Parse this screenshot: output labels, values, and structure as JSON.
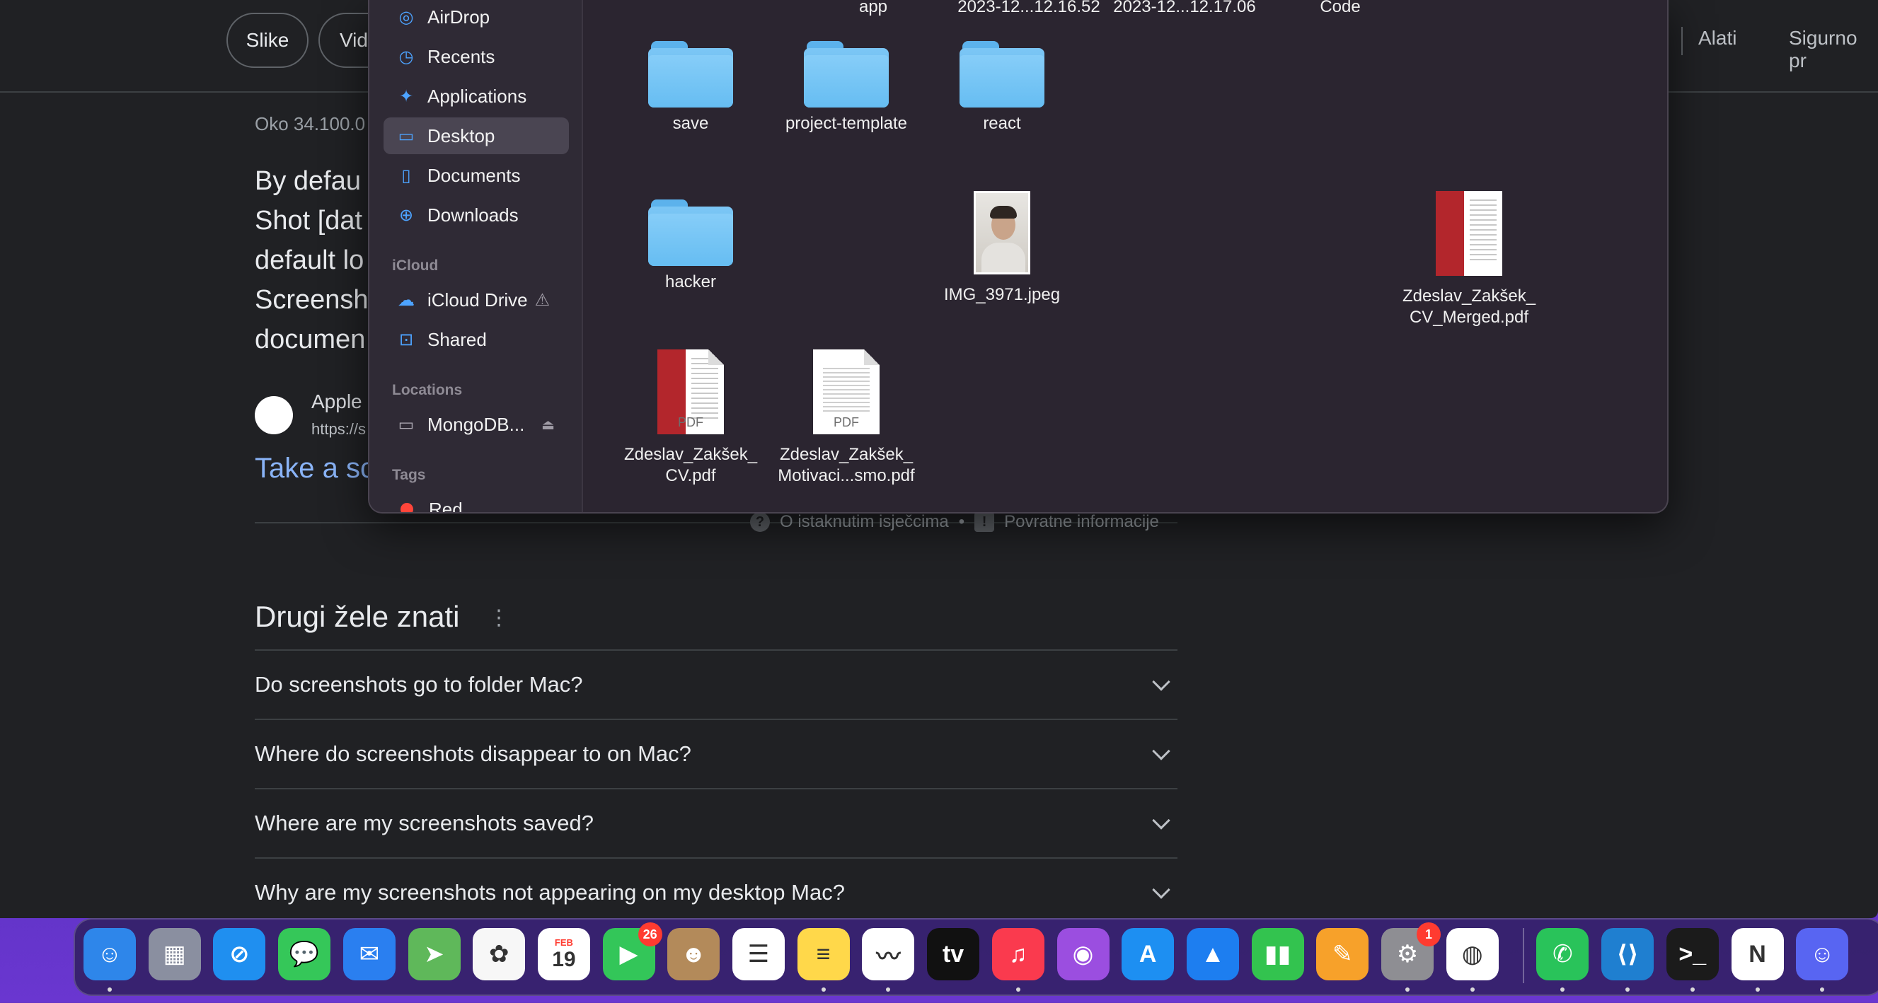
{
  "browser": {
    "chips": [
      "Slike",
      "Vid"
    ],
    "top_right": {
      "tools": "Alati",
      "safe": "Sigurno pr"
    },
    "meta": "Oko 34.100.0",
    "snippet_lines": [
      "By defau",
      "Shot [dat",
      "default lo",
      "Screensh",
      "documen"
    ],
    "source": {
      "name": "Apple",
      "url": "https://s"
    },
    "take_link": "Take a sc",
    "feedback": {
      "about": "O istaknutim isječcima",
      "sep": "•",
      "feedback": "Povratne informacije"
    },
    "paa_title": "Drugi žele znati",
    "paa": [
      "Do screenshots go to folder Mac?",
      "Where do screenshots disappear to on Mac?",
      "Where are my screenshots saved?",
      "Why are my screenshots not appearing on my desktop Mac?"
    ]
  },
  "finder": {
    "sidebar": {
      "favorites": [
        {
          "label": "AirDrop",
          "icon": "airdrop-icon",
          "glyph": "◎"
        },
        {
          "label": "Recents",
          "icon": "clock-icon",
          "glyph": "◷"
        },
        {
          "label": "Applications",
          "icon": "applications-icon",
          "glyph": "✦"
        },
        {
          "label": "Desktop",
          "icon": "desktop-icon",
          "glyph": "▭",
          "selected": true
        },
        {
          "label": "Documents",
          "icon": "document-icon",
          "glyph": "▯"
        },
        {
          "label": "Downloads",
          "icon": "download-icon",
          "glyph": "⊕"
        }
      ],
      "icloud_head": "iCloud",
      "icloud": [
        {
          "label": "iCloud Drive",
          "icon": "cloud-icon",
          "glyph": "☁",
          "warning": "⚠"
        },
        {
          "label": "Shared",
          "icon": "shared-folder-icon",
          "glyph": "⊡"
        }
      ],
      "locations_head": "Locations",
      "locations": [
        {
          "label": "MongoDB...",
          "icon": "drive-icon",
          "glyph": "▭",
          "eject": "⏏"
        }
      ],
      "tags_head": "Tags",
      "tags": [
        {
          "label": "Red",
          "color": "#ff453a"
        }
      ]
    },
    "top_row": [
      "app",
      "2023-12...12.16.52",
      "2023-12...12.17.06",
      "Code"
    ],
    "files": [
      {
        "name": "save",
        "type": "folder"
      },
      {
        "name": "project-template",
        "type": "folder"
      },
      {
        "name": "react",
        "type": "folder"
      },
      {
        "name": "hacker",
        "type": "folder"
      },
      {
        "name": "IMG_3971.jpeg",
        "type": "image"
      },
      {
        "name_l1": "Zdeslav_Zakšek_",
        "name_l2": "CV_Merged.pdf",
        "type": "pdf-red"
      },
      {
        "name_l1": "Zdeslav_Zakšek_",
        "name_l2": "CV.pdf",
        "type": "pdf-red",
        "tag": "PDF"
      },
      {
        "name_l1": "Zdeslav_Zakšek_",
        "name_l2": "Motivaci...smo.pdf",
        "type": "pdf-plain",
        "tag": "PDF"
      }
    ]
  },
  "dock": {
    "apps": [
      {
        "name": "Finder",
        "glyph": "☺",
        "bg": "#2e86ea",
        "running": true
      },
      {
        "name": "Launchpad",
        "glyph": "▦",
        "bg": "#8a8fa0"
      },
      {
        "name": "Safari",
        "glyph": "⊘",
        "bg": "#1f8ff0"
      },
      {
        "name": "Messages",
        "glyph": "💬",
        "bg": "#35c759"
      },
      {
        "name": "Mail",
        "glyph": "✉",
        "bg": "#2a7ff0"
      },
      {
        "name": "Maps",
        "glyph": "➤",
        "bg": "#5fb85a"
      },
      {
        "name": "Photos",
        "glyph": "✿",
        "bg": "#f7f7f7"
      },
      {
        "name": "Calendar",
        "glyph": "19",
        "month": "FEB",
        "bg": "#ffffff"
      },
      {
        "name": "FaceTime",
        "glyph": "▶",
        "bg": "#33c659",
        "badge": "26"
      },
      {
        "name": "Contacts",
        "glyph": "☻",
        "bg": "#b38a5a"
      },
      {
        "name": "Reminders",
        "glyph": "☰",
        "bg": "#ffffff"
      },
      {
        "name": "Notes",
        "glyph": "≡",
        "bg": "#ffd84a",
        "running": true
      },
      {
        "name": "Freeform",
        "glyph": "〰",
        "bg": "#ffffff",
        "running": true
      },
      {
        "name": "TV",
        "glyph": "tv",
        "bg": "#111111"
      },
      {
        "name": "Music",
        "glyph": "♫",
        "bg": "#fa3a4e",
        "running": true
      },
      {
        "name": "Podcasts",
        "glyph": "◉",
        "bg": "#9b4ee0"
      },
      {
        "name": "App Store",
        "glyph": "A",
        "bg": "#1d8ff2"
      },
      {
        "name": "Keynote",
        "glyph": "▲",
        "bg": "#1d7ef0"
      },
      {
        "name": "Numbers",
        "glyph": "▮▮",
        "bg": "#33c34f"
      },
      {
        "name": "Pages",
        "glyph": "✎",
        "bg": "#f7a12a"
      },
      {
        "name": "System Settings",
        "glyph": "⚙",
        "bg": "#8e8e93",
        "badge": "1",
        "running": true
      },
      {
        "name": "Chrome",
        "glyph": "◍",
        "bg": "#ffffff",
        "running": true
      },
      {
        "name": "WhatsApp",
        "glyph": "✆",
        "bg": "#29c35a",
        "running": true
      },
      {
        "name": "VS Code",
        "glyph": "⟨⟩",
        "bg": "#1f7fd0",
        "running": true
      },
      {
        "name": "Terminal",
        "glyph": ">_",
        "bg": "#1b1b1b",
        "running": true
      },
      {
        "name": "Notion",
        "glyph": "N",
        "bg": "#ffffff",
        "running": true
      },
      {
        "name": "Discord",
        "glyph": "☺",
        "bg": "#5865f2",
        "running": true
      }
    ]
  }
}
